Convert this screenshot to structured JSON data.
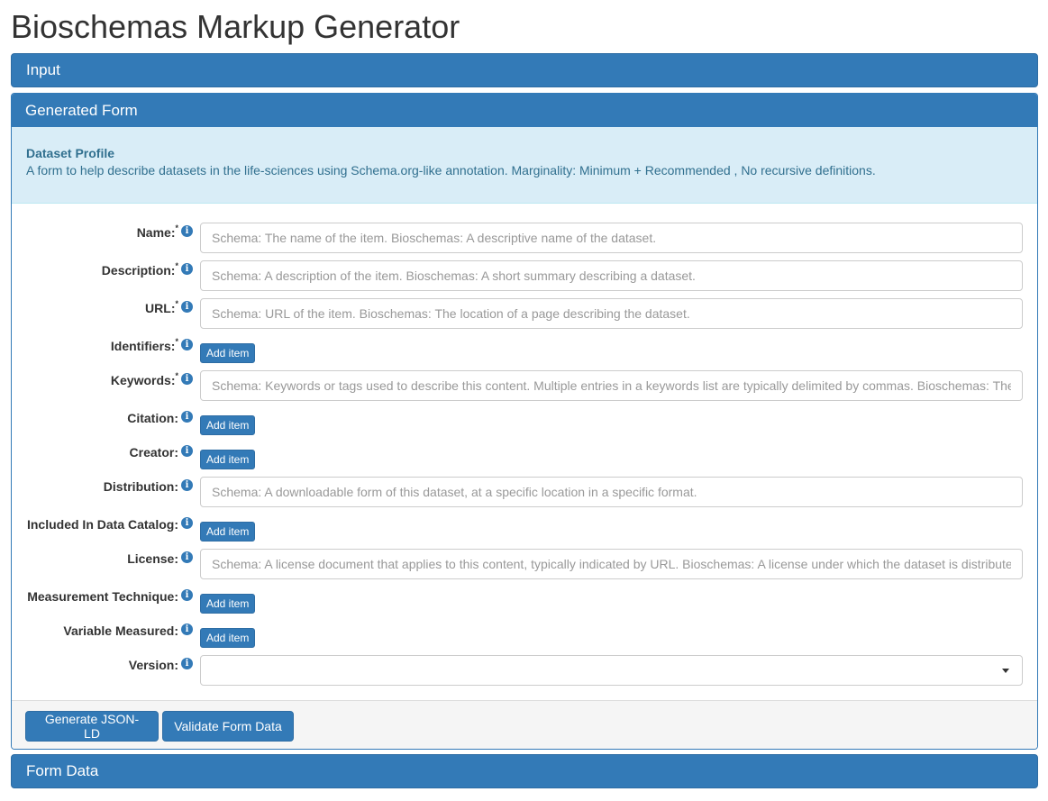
{
  "page": {
    "title": "Bioschemas Markup Generator"
  },
  "panels": {
    "input": "Input",
    "generated_form": "Generated Form",
    "form_data": "Form Data"
  },
  "profile": {
    "title": "Dataset Profile",
    "description": "A form to help describe datasets in the life-sciences using Schema.org-like annotation. Marginality: Minimum + Recommended , No recursive definitions."
  },
  "fields": {
    "name": {
      "label": "Name:",
      "required": "*",
      "placeholder": "Schema: The name of the item. Bioschemas: A descriptive name of the dataset."
    },
    "description": {
      "label": "Description:",
      "required": "*",
      "placeholder": "Schema: A description of the item. Bioschemas: A short summary describing a dataset."
    },
    "url": {
      "label": "URL:",
      "required": "*",
      "placeholder": "Schema: URL of the item. Bioschemas: The location of a page describing the dataset."
    },
    "identifiers": {
      "label": "Identifiers:",
      "required": "*",
      "button": "Add item"
    },
    "keywords": {
      "label": "Keywords:",
      "required": "*",
      "placeholder": "Schema: Keywords or tags used to describe this content. Multiple entries in a keywords list are typically delimited by commas. Bioschemas: The"
    },
    "citation": {
      "label": "Citation:",
      "button": "Add item"
    },
    "creator": {
      "label": "Creator:",
      "button": "Add item"
    },
    "distribution": {
      "label": "Distribution:",
      "placeholder": "Schema: A downloadable form of this dataset, at a specific location in a specific format."
    },
    "included_in_data_catalog": {
      "label": "Included In Data Catalog:",
      "button": "Add item"
    },
    "license": {
      "label": "License:",
      "placeholder": "Schema: A license document that applies to this content, typically indicated by URL. Bioschemas: A license under which the dataset is distribute"
    },
    "measurement_technique": {
      "label": "Measurement Technique:",
      "button": "Add item"
    },
    "variable_measured": {
      "label": "Variable Measured:",
      "button": "Add item"
    },
    "version": {
      "label": "Version:",
      "value": ""
    }
  },
  "info_icon_glyph": "i",
  "icons": {
    "info": "info-circle-icon",
    "dropdown": "caret-down-icon"
  },
  "footer": {
    "generate": "Generate JSON-LD",
    "validate": "Validate Form Data"
  },
  "colors": {
    "primary": "#337ab7",
    "info_bg": "#d9edf7",
    "info_text": "#31708f"
  }
}
